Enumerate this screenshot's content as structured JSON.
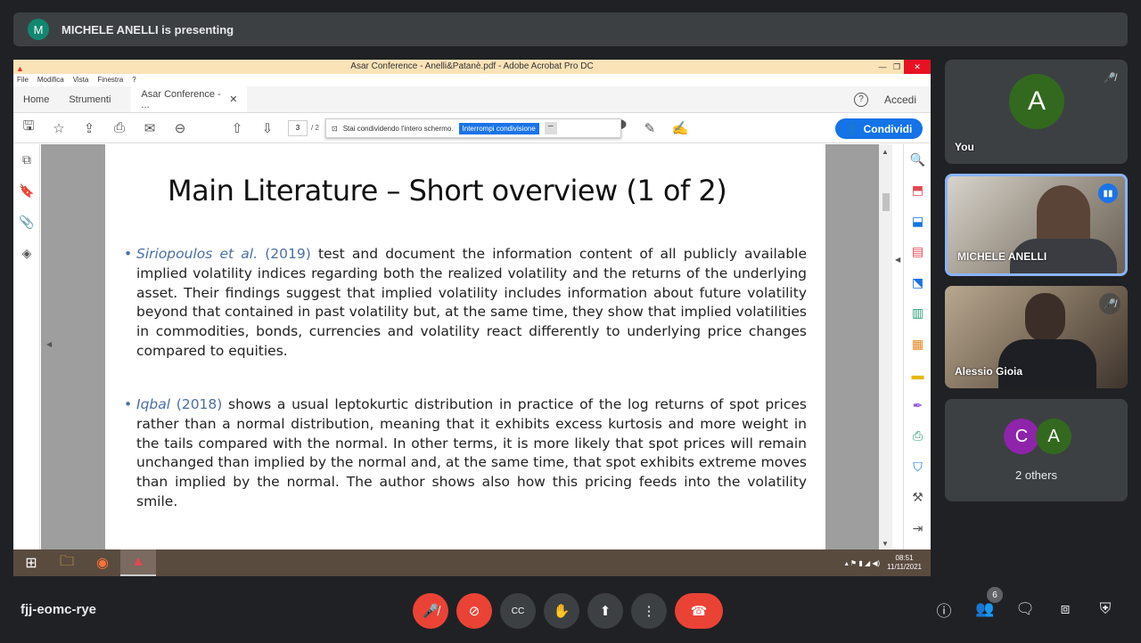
{
  "presenting": {
    "initial": "M",
    "text": "MICHELE ANELLI is presenting"
  },
  "acrobat": {
    "window_title": "Asar Conference - Anelli&Patanè.pdf - Adobe Acrobat Pro DC",
    "menu": [
      "File",
      "Modifica",
      "Vista",
      "Finestra",
      "?"
    ],
    "tabs": {
      "home": "Home",
      "tools": "Strumenti",
      "doc": "Asar Conference - ..."
    },
    "sign_in": "Accedi",
    "page_current": "3",
    "page_sep": "/ 2",
    "share_banner_text": "Stai condividendo l'intero schermo.",
    "share_stop": "Interrompi condivisione",
    "share_button": "Condividi"
  },
  "slide": {
    "title": "Main Literature – Short overview (1 of 2)",
    "bullet1": {
      "cite_author": "Siriopoulos et al.",
      "cite_year": "(2019)",
      "text": "test and document the information content of all publicly available implied volatility indices regarding both the realized volatility and the returns of the underlying asset. Their findings suggest that implied volatility includes information about future volatility beyond that contained in past volatility but, at the same time, they show that implied volatilities in commodities, bonds, currencies and volatility react differently to underlying price changes compared to equities."
    },
    "bullet2": {
      "cite_author": "Iqbal",
      "cite_year": "(2018)",
      "text": "shows a usual leptokurtic distribution in practice of the log returns of spot prices rather than a normal distribution, meaning that it exhibits excess kurtosis and more weight in the tails compared with the normal. In other terms, it is more likely that spot prices will remain unchanged than implied by the normal and, at the same time, that spot exhibits extreme moves than implied by the normal. The author shows also how this pricing feeds into the volatility smile."
    }
  },
  "taskbar": {
    "time": "08:51",
    "date": "11/11/2021"
  },
  "participants": {
    "you": {
      "initial": "A",
      "name": "You"
    },
    "presenter": {
      "name": "MICHELE ANELLI"
    },
    "p3": {
      "name": "Alessio Gioia"
    },
    "others": {
      "initials": [
        "C",
        "A"
      ],
      "label": "2 others"
    }
  },
  "meeting": {
    "code": "fjj-eomc-rye",
    "people_count": "6"
  },
  "colors": {
    "accent": "#1a73e8",
    "danger": "#ea4335",
    "bg": "#202124"
  }
}
